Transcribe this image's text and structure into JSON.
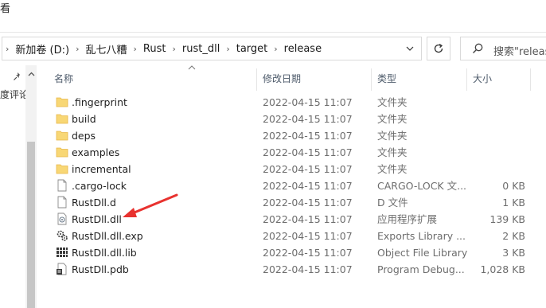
{
  "menu": {
    "view_label": "看"
  },
  "address": {
    "crumbs": [
      "新加卷 (D:)",
      "乱七八糟",
      "Rust",
      "rust_dll",
      "target",
      "release"
    ]
  },
  "search": {
    "text": "搜索\"release\""
  },
  "nav": {
    "label": "度评论"
  },
  "columns": {
    "name": "名称",
    "date": "修改日期",
    "type": "类型",
    "size": "大小"
  },
  "files": [
    {
      "name": ".fingerprint",
      "date": "2022-04-15 11:07",
      "type": "文件夹",
      "size": "",
      "icon": "folder-icon"
    },
    {
      "name": "build",
      "date": "2022-04-15 11:07",
      "type": "文件夹",
      "size": "",
      "icon": "folder-icon"
    },
    {
      "name": "deps",
      "date": "2022-04-15 11:07",
      "type": "文件夹",
      "size": "",
      "icon": "folder-icon"
    },
    {
      "name": "examples",
      "date": "2022-04-15 11:07",
      "type": "文件夹",
      "size": "",
      "icon": "folder-icon"
    },
    {
      "name": "incremental",
      "date": "2022-04-15 11:07",
      "type": "文件夹",
      "size": "",
      "icon": "folder-icon"
    },
    {
      "name": ".cargo-lock",
      "date": "2022-04-15 11:07",
      "type": "CARGO-LOCK 文...",
      "size": "0 KB",
      "icon": "file-icon"
    },
    {
      "name": "RustDll.d",
      "date": "2022-04-15 11:07",
      "type": "D 文件",
      "size": "1 KB",
      "icon": "file-icon"
    },
    {
      "name": "RustDll.dll",
      "date": "2022-04-15 11:07",
      "type": "应用程序扩展",
      "size": "139 KB",
      "icon": "dll-icon"
    },
    {
      "name": "RustDll.dll.exp",
      "date": "2022-04-15 11:07",
      "type": "Exports Library ...",
      "size": "2 KB",
      "icon": "exp-icon"
    },
    {
      "name": "RustDll.dll.lib",
      "date": "2022-04-15 11:07",
      "type": "Object File Library",
      "size": "3 KB",
      "icon": "lib-icon"
    },
    {
      "name": "RustDll.pdb",
      "date": "2022-04-15 11:07",
      "type": "Program Debug...",
      "size": "1,028 KB",
      "icon": "pdb-icon"
    }
  ],
  "colors": {
    "folder": "#f8d775",
    "folder_dark": "#e8b84a",
    "arrow": "#e8322f"
  }
}
